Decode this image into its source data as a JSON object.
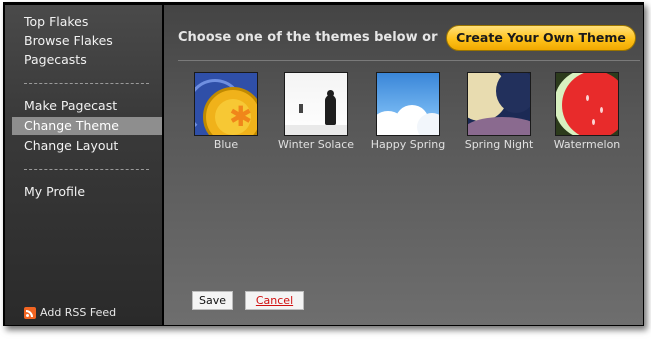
{
  "sidebar": {
    "top_links": [
      "Top Flakes",
      "Browse Flakes",
      "Pagecasts"
    ],
    "menu": [
      "Make Pagecast",
      "Change Theme",
      "Change Layout"
    ],
    "active": "Change Theme",
    "profile": "My Profile",
    "rss": "Add RSS Feed"
  },
  "main": {
    "heading": "Choose one of the themes below or",
    "create_button": "Create Your Own Theme",
    "themes": [
      "Blue",
      "Winter Solace",
      "Happy Spring",
      "Spring Night",
      "Watermelon"
    ],
    "save_label": "Save",
    "cancel_label": "Cancel"
  },
  "colors": {
    "accent": "#ffc21a",
    "active_item": "#8e8e8e",
    "cancel_text": "#d01010"
  }
}
